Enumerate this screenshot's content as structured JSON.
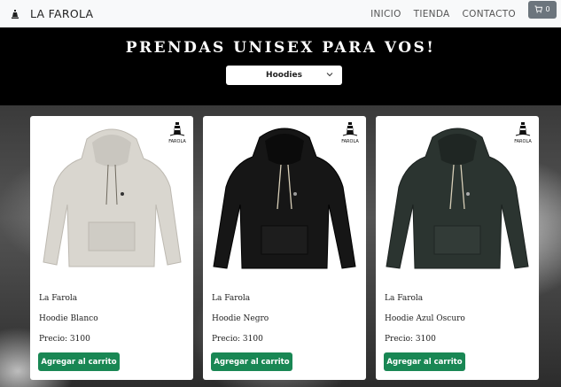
{
  "brand": {
    "name": "LA FAROLA"
  },
  "nav": {
    "items": [
      "INICIO",
      "TIENDA",
      "CONTACTO"
    ],
    "cart_count": "0"
  },
  "hero": {
    "title": "PRENDAS UNISEX PARA VOS!",
    "select_value": "Hoodies"
  },
  "products": [
    {
      "brand": "La Farola",
      "name": "Hoodie Blanco",
      "price": "Precio: 3100",
      "button": "Agregar al carrito",
      "color": "#d9d6cf"
    },
    {
      "brand": "La Farola",
      "name": "Hoodie Negro",
      "price": "Precio: 3100",
      "button": "Agregar al carrito",
      "color": "#161616"
    },
    {
      "brand": "La Farola",
      "name": "Hoodie Azul Oscuro",
      "price": "Precio: 3100",
      "button": "Agregar al carrito",
      "color": "#2b3430"
    }
  ],
  "badge": {
    "text": "FAROLA"
  },
  "colors": {
    "navbar": "#f8f9fa",
    "hero": "#000000",
    "button": "#198754",
    "cart": "#6c757d"
  }
}
